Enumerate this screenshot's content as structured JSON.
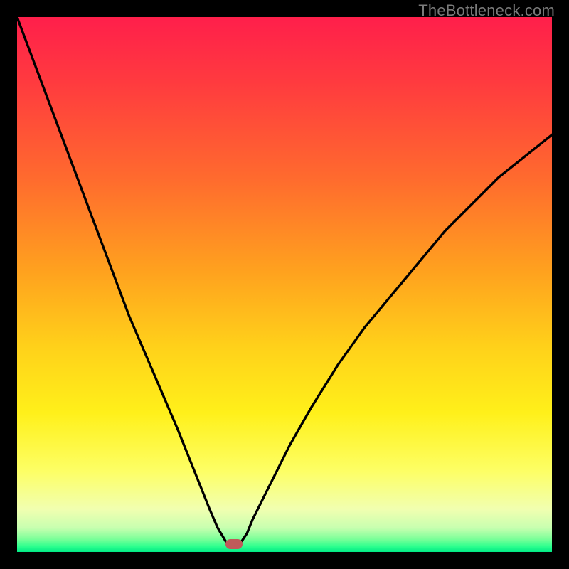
{
  "watermark": "TheBottleneck.com",
  "chart_data": {
    "type": "line",
    "title": "",
    "xlabel": "",
    "ylabel": "",
    "xlim": [
      0,
      100
    ],
    "ylim": [
      0,
      100
    ],
    "grid": false,
    "legend": false,
    "gradient_stops": [
      {
        "pos": 0.0,
        "color": "#ff1f4b"
      },
      {
        "pos": 0.12,
        "color": "#ff3a3f"
      },
      {
        "pos": 0.3,
        "color": "#ff6a2e"
      },
      {
        "pos": 0.48,
        "color": "#ffa31e"
      },
      {
        "pos": 0.62,
        "color": "#ffd21a"
      },
      {
        "pos": 0.74,
        "color": "#fff01a"
      },
      {
        "pos": 0.85,
        "color": "#fdff66"
      },
      {
        "pos": 0.92,
        "color": "#f1ffb0"
      },
      {
        "pos": 0.955,
        "color": "#c8ffb0"
      },
      {
        "pos": 0.975,
        "color": "#7fff9a"
      },
      {
        "pos": 0.99,
        "color": "#2cff8e"
      },
      {
        "pos": 1.0,
        "color": "#00e885"
      }
    ],
    "series": [
      {
        "name": "bottleneck-curve",
        "x": [
          0,
          3,
          6,
          9,
          12,
          15,
          18,
          21,
          24,
          27,
          30,
          32,
          34,
          36,
          37.5,
          39,
          40,
          41,
          42,
          43,
          44,
          46,
          48,
          51,
          55,
          60,
          65,
          70,
          75,
          80,
          85,
          90,
          95,
          100
        ],
        "y": [
          100,
          92,
          84,
          76,
          68,
          60,
          52,
          44,
          37,
          30,
          23,
          18,
          13,
          8,
          4.5,
          2,
          1,
          1,
          2,
          3.5,
          6,
          10,
          14,
          20,
          27,
          35,
          42,
          48,
          54,
          60,
          65,
          70,
          74,
          78
        ]
      }
    ],
    "marker": {
      "x": 40.5,
      "y": 1.5,
      "color": "#c05a5a"
    }
  }
}
